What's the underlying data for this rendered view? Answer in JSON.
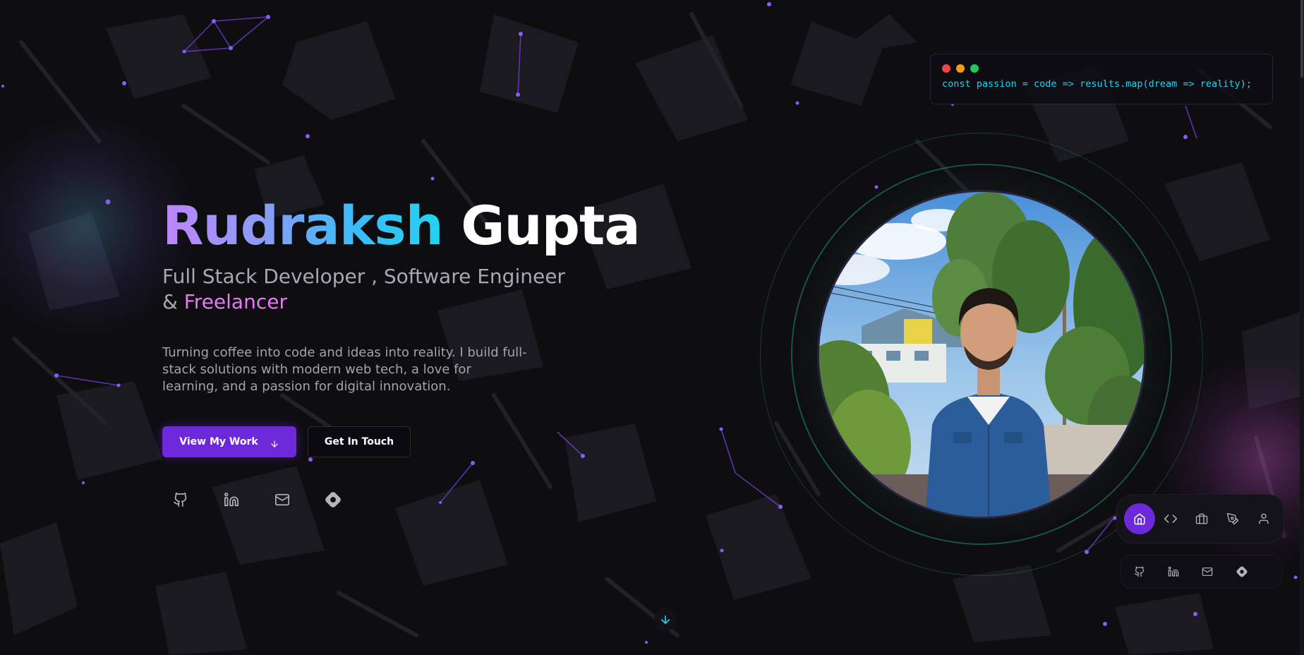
{
  "hero": {
    "first_name": "Rudraksh",
    "last_name": "Gupta",
    "role_line1": "Full Stack Developer , Software Engineer",
    "role_amp": "& ",
    "role_accent": "Freelancer",
    "description": "Turning coffee into code and ideas into reality. I build full-stack solutions with modern web tech, a love for learning, and a passion for digital innovation.",
    "primary_button": "View My Work",
    "secondary_button": "Get In Touch"
  },
  "socials": [
    "github-icon",
    "linkedin-icon",
    "mail-icon",
    "hashnode-icon"
  ],
  "code_card": {
    "code": "const passion = code => results.map(dream => reality);",
    "dot_colors": [
      "#ef4444",
      "#f59e0b",
      "#22c55e"
    ]
  },
  "dock": {
    "items": [
      "home-icon",
      "code-icon",
      "briefcase-icon",
      "pen-icon",
      "user-icon"
    ],
    "active": "home-icon"
  },
  "dock_socials": [
    "github-icon",
    "linkedin-icon",
    "mail-icon",
    "hashnode-icon"
  ],
  "colors": {
    "accent": "#6d28d9",
    "cyan": "#22d3ee",
    "pink": "#e879f9",
    "background": "#0e0d10"
  }
}
